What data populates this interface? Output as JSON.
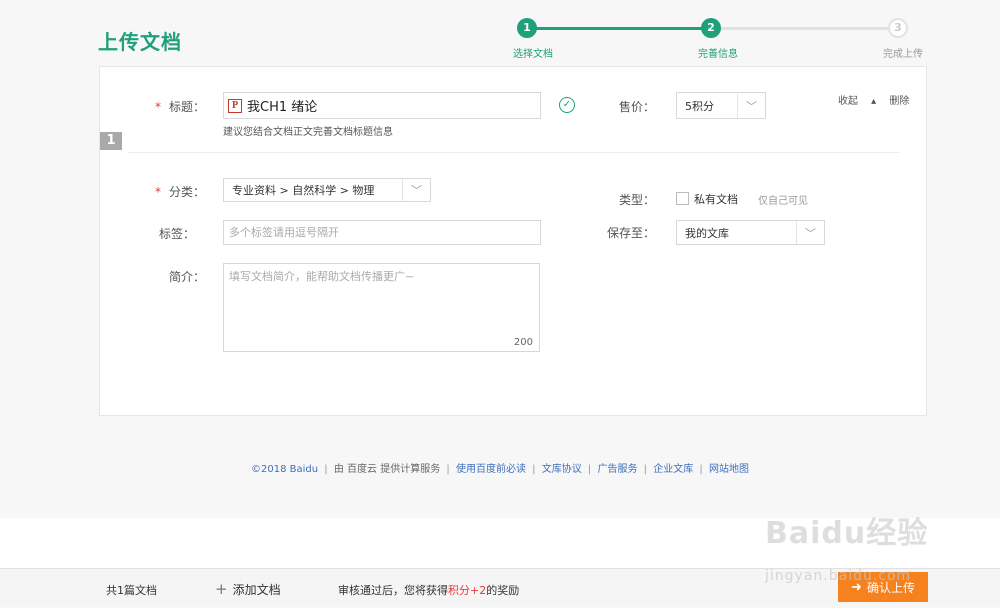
{
  "page_title": "上传文档",
  "steps": [
    {
      "num": "1",
      "label": "选择文档"
    },
    {
      "num": "2",
      "label": "完善信息"
    },
    {
      "num": "3",
      "label": "完成上传"
    }
  ],
  "form": {
    "section_number": "1",
    "title_label": "标题：",
    "title_value": "我CH1 绪论",
    "file_type_badge": "P",
    "title_hint": "建议您结合文档正文完善文档标题信息",
    "price_label": "售价：",
    "price_value": "5积分",
    "collapse_label": "收起",
    "delete_label": "删除",
    "category_label": "分类：",
    "category_value": "专业资料 > 自然科学 > 物理",
    "type_label": "类型：",
    "private_label": "私有文档",
    "private_hint": "仅自己可见",
    "tags_label": "标签：",
    "tags_placeholder": "多个标签请用逗号隔开",
    "save_label": "保存至：",
    "save_value": "我的文库",
    "intro_label": "简介：",
    "intro_placeholder": "填写文档简介，能帮助文档传播更广~",
    "intro_counter": "200",
    "required_mark": "*"
  },
  "footer": {
    "copyright": "©2018 Baidu",
    "provider": "由 百度云 提供计算服务",
    "links": [
      "使用百度前必读",
      "文库协议",
      "广告服务",
      "企业文库",
      "网站地图"
    ]
  },
  "bottom_bar": {
    "count": "共1篇文档",
    "add_label": "添加文档",
    "reward_prefix": "审核通过后，您将获得",
    "reward_highlight": "积分+2",
    "reward_suffix": "的奖励",
    "confirm_label": "确认上传"
  },
  "watermark": "Baidu经验",
  "watermark_url": "jingyan.baidu.com",
  "colors": {
    "accent": "#1ea178",
    "confirm": "#f6811f",
    "required": "#e4393c"
  }
}
